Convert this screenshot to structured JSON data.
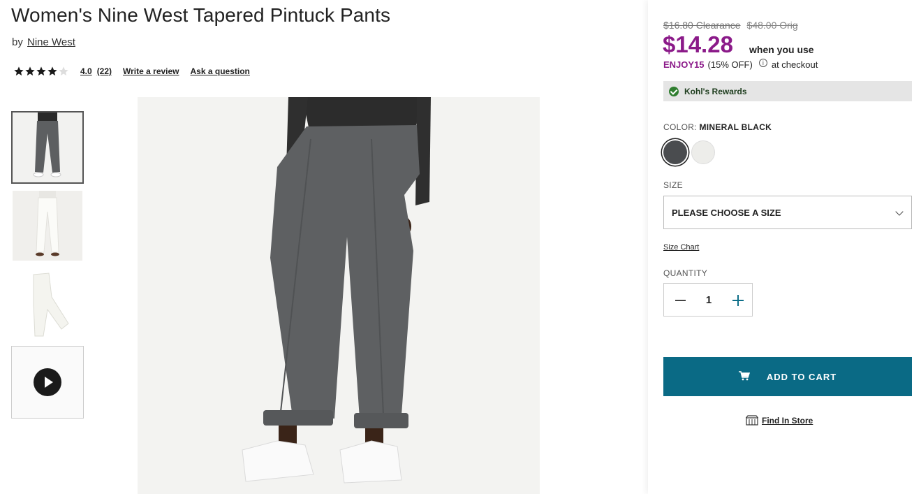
{
  "product": {
    "title": "Women's Nine West Tapered Pintuck Pants",
    "by_prefix": "by",
    "brand": "Nine West"
  },
  "rating": {
    "stars": 4.0,
    "value": "4.0",
    "count": "(22)",
    "write_review": "Write a review",
    "ask_question": "Ask a question"
  },
  "gallery": {
    "thumbnails": [
      "main-gray",
      "front-white",
      "flat-white",
      "video"
    ],
    "selected_index": 0
  },
  "pricing": {
    "clearance": "$16.80 Clearance",
    "original": "$48.00 Orig",
    "sale_price": "$14.28",
    "when_you_use": "when you use",
    "promo_code": "ENJOY15",
    "promo_off": "(15% OFF)",
    "info_icon": "i",
    "at_checkout": "at checkout"
  },
  "rewards": {
    "label": "Kohl's Rewards"
  },
  "color": {
    "label": "COLOR:",
    "selected": "MINERAL BLACK",
    "swatches": [
      {
        "name": "Mineral Black",
        "hex": "#4a4c4f"
      },
      {
        "name": "White",
        "hex": "#ededea"
      }
    ]
  },
  "size": {
    "label": "SIZE",
    "placeholder": "PLEASE CHOOSE A SIZE",
    "size_chart": "Size Chart"
  },
  "quantity": {
    "label": "QUANTITY",
    "value": "1"
  },
  "actions": {
    "add_to_cart": "ADD TO CART",
    "find_in_store": "Find In Store"
  },
  "colors": {
    "accent_purple": "#8b1a89",
    "cart_teal": "#0a6a85"
  }
}
